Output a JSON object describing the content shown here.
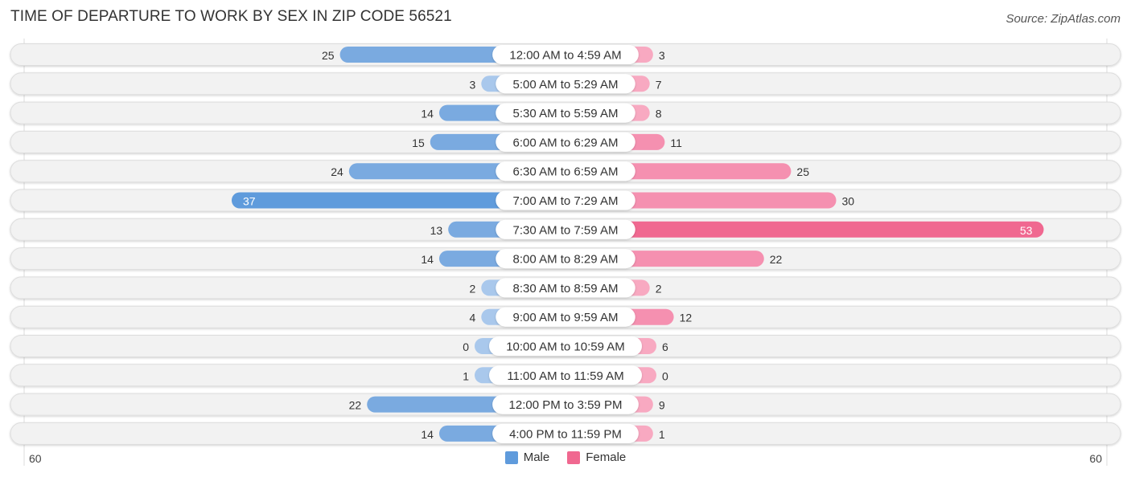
{
  "header": {
    "title": "TIME OF DEPARTURE TO WORK BY SEX IN ZIP CODE 56521",
    "source": "Source: ZipAtlas.com"
  },
  "colors": {
    "male": "#7aaae0",
    "male_light": "#a9c8ec",
    "male_strong": "#5f9bdc",
    "female": "#f590b0",
    "female_light": "#f8a9c1",
    "female_strong": "#f06890",
    "row_bg": "#f2f2f2"
  },
  "chart_data": {
    "type": "bar",
    "orientation": "horizontal-diverging",
    "title": "TIME OF DEPARTURE TO WORK BY SEX IN ZIP CODE 56521",
    "categories": [
      "12:00 AM to 4:59 AM",
      "5:00 AM to 5:29 AM",
      "5:30 AM to 5:59 AM",
      "6:00 AM to 6:29 AM",
      "6:30 AM to 6:59 AM",
      "7:00 AM to 7:29 AM",
      "7:30 AM to 7:59 AM",
      "8:00 AM to 8:29 AM",
      "8:30 AM to 8:59 AM",
      "9:00 AM to 9:59 AM",
      "10:00 AM to 10:59 AM",
      "11:00 AM to 11:59 AM",
      "12:00 PM to 3:59 PM",
      "4:00 PM to 11:59 PM"
    ],
    "series": [
      {
        "name": "Male",
        "values": [
          25,
          3,
          14,
          15,
          24,
          37,
          13,
          14,
          2,
          4,
          0,
          1,
          22,
          14
        ]
      },
      {
        "name": "Female",
        "values": [
          3,
          7,
          8,
          11,
          25,
          30,
          53,
          22,
          2,
          12,
          6,
          0,
          9,
          1
        ]
      }
    ],
    "axis": {
      "left_label": "60",
      "right_label": "60",
      "range": [
        -60,
        60
      ]
    },
    "legend": {
      "position": "bottom-center",
      "entries": [
        "Male",
        "Female"
      ]
    },
    "grid": false
  }
}
